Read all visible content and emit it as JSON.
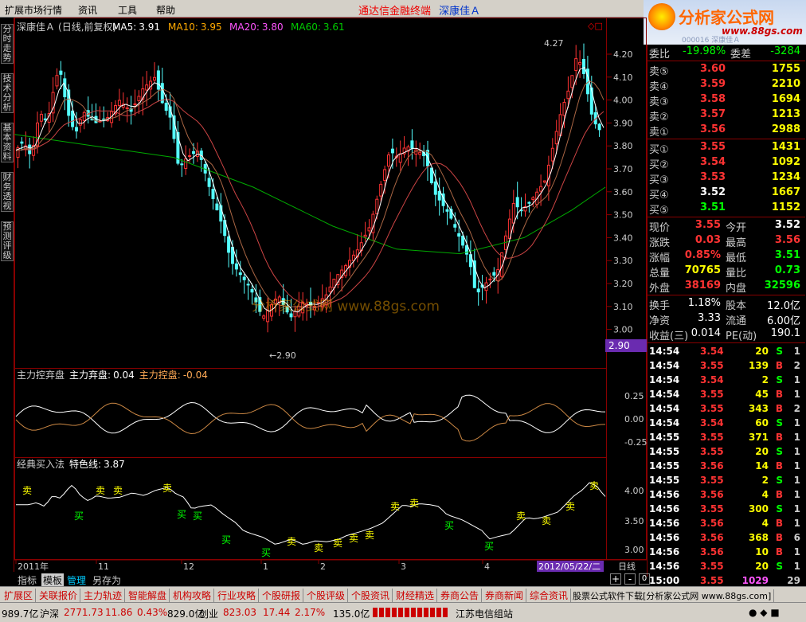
{
  "menubar": {
    "items": [
      "扩展市场行情",
      "资讯",
      "工具",
      "帮助"
    ],
    "title_red": "通达信金融终端",
    "title_blue": "深康佳Ａ"
  },
  "logo": {
    "text": "分析家公式网",
    "url": "www.88gs.com",
    "sub": "000016 深康佳Ａ"
  },
  "sidebar": [
    "分时走势",
    "技术分析",
    "基本资料",
    "财务透视",
    "预测评级"
  ],
  "main": {
    "stock": "深康佳Ａ",
    "period": "(日线,前复权)",
    "ma": [
      {
        "label": "MA5:",
        "value": "3.91",
        "color": "#ffffff"
      },
      {
        "label": "MA10:",
        "value": "3.95",
        "color": "#ffaa00"
      },
      {
        "label": "MA20:",
        "value": "3.80",
        "color": "#ff55ff"
      },
      {
        "label": "MA60:",
        "value": "3.61",
        "color": "#00cc00"
      }
    ],
    "yticks": [
      "4.20",
      "4.10",
      "4.00",
      "3.90",
      "3.80",
      "3.70",
      "3.60",
      "3.50",
      "3.40",
      "3.30",
      "3.20",
      "3.10",
      "3.00"
    ],
    "high_label": "4.27",
    "low_label": "←2.90",
    "cursor_price": "2.90",
    "watermark": "分析家公式网 www.88gs.com"
  },
  "ind1": {
    "name": "主力控弃盘",
    "l1": "主力弃盘:",
    "v1": "0.04",
    "l2": "主力控盘:",
    "v2": "-0.04",
    "yticks": [
      "0.25",
      "0.00",
      "-0.25"
    ]
  },
  "ind2": {
    "name": "经典买入法",
    "l1": "特色线:",
    "v1": "3.87",
    "yticks": [
      "4.00",
      "3.50",
      "3.00"
    ],
    "buy": "买",
    "sell": "卖"
  },
  "xaxis": {
    "labels": [
      "2011年",
      "11",
      "12",
      "1",
      "2",
      "3",
      "4"
    ],
    "date": "2012/05/22/二",
    "period": "日线"
  },
  "quote": {
    "weibi": {
      "l": "委比",
      "v": "-19.98%",
      "l2": "委差",
      "v2": "-3284"
    },
    "sell": [
      {
        "l": "卖⑤",
        "p": "3.60",
        "v": "1755"
      },
      {
        "l": "卖④",
        "p": "3.59",
        "v": "2210"
      },
      {
        "l": "卖③",
        "p": "3.58",
        "v": "1694"
      },
      {
        "l": "卖②",
        "p": "3.57",
        "v": "1213"
      },
      {
        "l": "卖①",
        "p": "3.56",
        "v": "2988"
      }
    ],
    "buy": [
      {
        "l": "买①",
        "p": "3.55",
        "v": "1431"
      },
      {
        "l": "买②",
        "p": "3.54",
        "v": "1092"
      },
      {
        "l": "买③",
        "p": "3.53",
        "v": "1234"
      },
      {
        "l": "买④",
        "p": "3.52",
        "v": "1667"
      },
      {
        "l": "买⑤",
        "p": "3.51",
        "v": "1152"
      }
    ],
    "info": [
      {
        "l": "现价",
        "v": "3.55",
        "c": "#ff3333",
        "l2": "今开",
        "v2": "3.52",
        "c2": "#ffffff"
      },
      {
        "l": "涨跌",
        "v": "0.03",
        "c": "#ff3333",
        "l2": "最高",
        "v2": "3.56",
        "c2": "#ff3333"
      },
      {
        "l": "涨幅",
        "v": "0.85%",
        "c": "#ff3333",
        "l2": "最低",
        "v2": "3.51",
        "c2": "#00ff00"
      },
      {
        "l": "总量",
        "v": "70765",
        "c": "#ffff00",
        "l2": "量比",
        "v2": "0.73",
        "c2": "#00ff00"
      },
      {
        "l": "外盘",
        "v": "38169",
        "c": "#ff3333",
        "l2": "内盘",
        "v2": "32596",
        "c2": "#00ff00"
      }
    ],
    "info2": [
      {
        "l": "换手",
        "v": "1.18%",
        "l2": "股本",
        "v2": "12.0亿"
      },
      {
        "l": "净资",
        "v": "3.33",
        "l2": "流通",
        "v2": "6.00亿"
      },
      {
        "l": "收益(三)",
        "v": "0.014",
        "l2": "PE(动)",
        "v2": "190.1"
      }
    ],
    "ticks": [
      {
        "t": "14:54",
        "p": "3.54",
        "v": "20",
        "s": "S",
        "n": "1"
      },
      {
        "t": "14:54",
        "p": "3.55",
        "v": "139",
        "s": "B",
        "n": "2"
      },
      {
        "t": "14:54",
        "p": "3.54",
        "v": "2",
        "s": "S",
        "n": "1"
      },
      {
        "t": "14:54",
        "p": "3.55",
        "v": "45",
        "s": "B",
        "n": "1"
      },
      {
        "t": "14:54",
        "p": "3.55",
        "v": "343",
        "s": "B",
        "n": "2"
      },
      {
        "t": "14:54",
        "p": "3.54",
        "v": "60",
        "s": "S",
        "n": "1"
      },
      {
        "t": "14:55",
        "p": "3.55",
        "v": "371",
        "s": "B",
        "n": "1"
      },
      {
        "t": "14:55",
        "p": "3.55",
        "v": "20",
        "s": "S",
        "n": "1"
      },
      {
        "t": "14:55",
        "p": "3.56",
        "v": "14",
        "s": "B",
        "n": "1"
      },
      {
        "t": "14:55",
        "p": "3.55",
        "v": "2",
        "s": "S",
        "n": "1"
      },
      {
        "t": "14:56",
        "p": "3.56",
        "v": "4",
        "s": "B",
        "n": "1"
      },
      {
        "t": "14:56",
        "p": "3.55",
        "v": "300",
        "s": "S",
        "n": "1"
      },
      {
        "t": "14:56",
        "p": "3.56",
        "v": "4",
        "s": "B",
        "n": "1"
      },
      {
        "t": "14:56",
        "p": "3.56",
        "v": "368",
        "s": "B",
        "n": "6"
      },
      {
        "t": "14:56",
        "p": "3.56",
        "v": "10",
        "s": "B",
        "n": "1"
      },
      {
        "t": "14:56",
        "p": "3.55",
        "v": "20",
        "s": "S",
        "n": "1"
      },
      {
        "t": "15:00",
        "p": "3.55",
        "v": "1029",
        "s": "",
        "n": "29"
      }
    ]
  },
  "bottomtabs": [
    "指标",
    "模板",
    "管理",
    "另存为"
  ],
  "navbar": [
    "扩展区",
    "关联报价",
    "主力轨迹",
    "智能解盘",
    "机构攻略",
    "行业攻略",
    "个股研报",
    "个股评级",
    "个股资讯",
    "财经精选",
    "券商公告",
    "券商新闻",
    "综合资讯"
  ],
  "navbar_right": "股票公式软件下载[分析家公式网 www.88gs.com]",
  "statusbar": {
    "a": "989.7亿",
    "b": "沪深",
    "c": "2771.73",
    "d": "11.86",
    "e": "0.43%",
    "f": "829.0亿",
    "g": "创业",
    "h": "823.03",
    "i": "17.44",
    "j": "2.17%",
    "k": "135.0亿",
    "l": "江苏电信组站"
  }
}
